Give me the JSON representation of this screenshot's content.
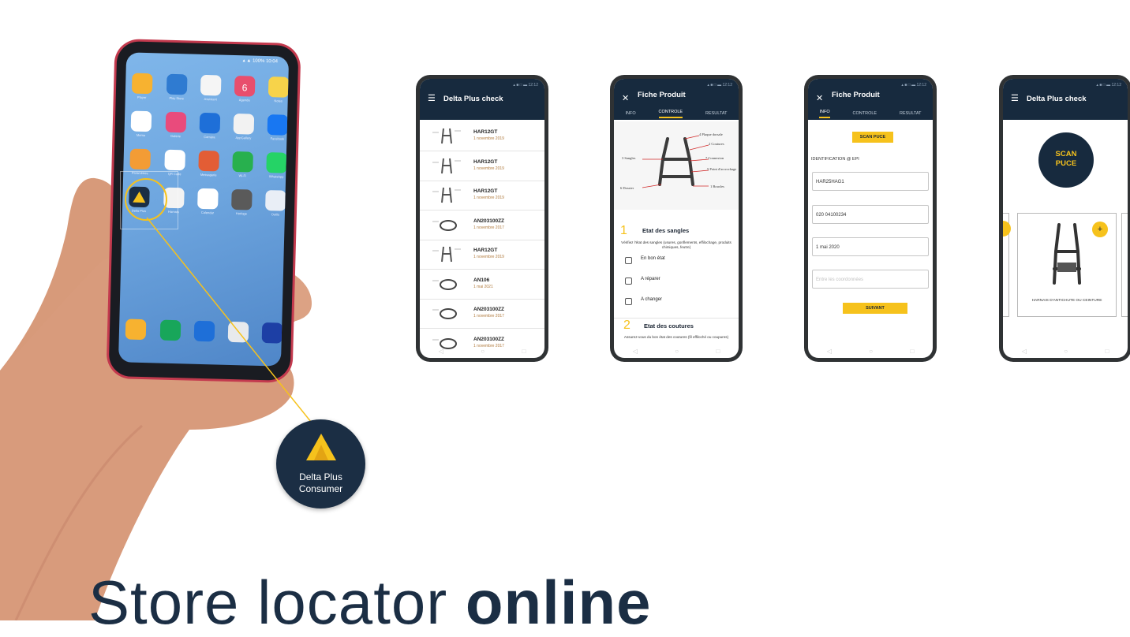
{
  "callout": {
    "line1": "Delta Plus",
    "line2": "Consumer"
  },
  "big_phone": {
    "status": "▴ ▲ 100% 10:04",
    "calendar_day": "6",
    "labels": [
      "Player",
      "Play Store",
      "Assistant",
      "Agenda",
      "Notes",
      "Memo",
      "Galerie",
      "Caméra",
      "AppGallery",
      "Facebook",
      "Paramètres",
      "QR Code",
      "Messagerie",
      "Wi-Fi",
      "WhatsApp",
      "Delta Plus",
      "Harnais",
      "Calendar",
      "Horloge",
      "Outils"
    ]
  },
  "screen1": {
    "title": "Delta Plus check",
    "time": "▴ ■ □ ▬ 12:12",
    "items": [
      {
        "code": "HAR12GT",
        "date": "1 novembre 2019"
      },
      {
        "code": "HAR12GT",
        "date": "1 novembre 2019"
      },
      {
        "code": "HAR12GT",
        "date": "1 novembre 2019"
      },
      {
        "code": "AN203100ZZ",
        "date": "1 novembre 2017"
      },
      {
        "code": "HAR12GT",
        "date": "1 novembre 2019"
      },
      {
        "code": "AN106",
        "date": "1 mai 2021"
      },
      {
        "code": "AN203100ZZ",
        "date": "1 novembre 2017"
      },
      {
        "code": "AN203100ZZ",
        "date": "1 novembre 2017"
      }
    ]
  },
  "screen2": {
    "title": "Fiche Produit",
    "time": "▴ ■ □ ▬ 12:12",
    "tabs": [
      "INFO",
      "CONTROLE",
      "RESULTAT"
    ],
    "diagram_labels": {
      "a": "4 Plaque dorsale",
      "b": "2 Coutures",
      "c": "3 Sangles",
      "d": "7 Connexion",
      "e": "5 Point d'accrochage",
      "f": "6 Dossier",
      "g": "1 Boucles"
    },
    "section1": {
      "num": "1",
      "title": "Etat des sangles",
      "desc": "Vérifiez l'état des sangles (usures, gonflements, effilochage, produits chimiques, feutre)"
    },
    "options": [
      "En bon état",
      "A réparer",
      "A changer"
    ],
    "section2": {
      "num": "2",
      "title": "Etat des coutures",
      "desc": "Assurez-vous du bon état des coutures (fil effiloché ou coupures)"
    }
  },
  "screen3": {
    "title": "Fiche Produit",
    "time": "▴ ■ □ ▬ 12:12",
    "tabs": [
      "INFO",
      "CONTROLE",
      "RESULTAT"
    ],
    "scan_label": "SCAN PUCE",
    "identification": "IDENTIFICATION @ EPI",
    "fields": [
      "HAR25HAG1",
      "020 04100234",
      "1 mai 2020"
    ],
    "placeholder": "Entre les coordonnées",
    "next_label": "SUIVANT"
  },
  "screen4": {
    "title": "Delta Plus check",
    "time": "▴ ■ □ ▬ 12:12",
    "scan_line1": "SCAN",
    "scan_line2": "PUCE",
    "card_caption": "HARNAIS D'ANTICHUTE OU CEINTURE",
    "plus": "+"
  },
  "banner": {
    "light": "Store locator ",
    "bold": "online"
  },
  "colors": {
    "navy": "#172a3e",
    "yellow": "#f6c21c",
    "phone_red": "#c33a4e"
  }
}
